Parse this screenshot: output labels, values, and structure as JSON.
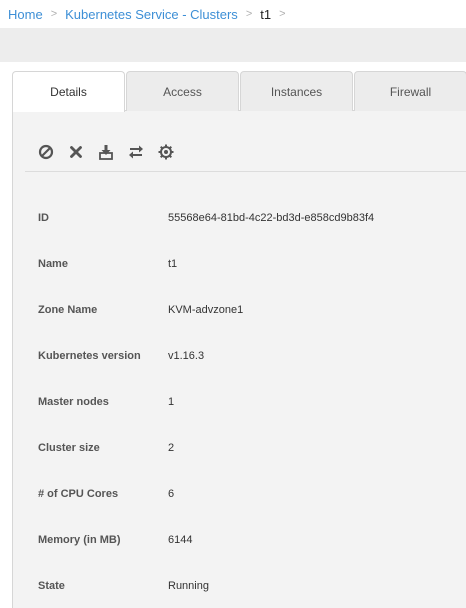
{
  "breadcrumb": {
    "home": "Home",
    "section": "Kubernetes Service - Clusters",
    "current": "t1",
    "separator": ">"
  },
  "tabs": [
    {
      "label": "Details",
      "active": true
    },
    {
      "label": "Access",
      "active": false
    },
    {
      "label": "Instances",
      "active": false
    },
    {
      "label": "Firewall",
      "active": false
    }
  ],
  "actions": [
    {
      "icon": "ban-icon"
    },
    {
      "icon": "close-icon"
    },
    {
      "icon": "download-icon"
    },
    {
      "icon": "swap-icon"
    },
    {
      "icon": "gear-icon"
    }
  ],
  "details": [
    {
      "label": "ID",
      "value": "55568e64-81bd-4c22-bd3d-e858cd9b83f4"
    },
    {
      "label": "Name",
      "value": "t1"
    },
    {
      "label": "Zone Name",
      "value": "KVM-advzone1"
    },
    {
      "label": "Kubernetes version",
      "value": "v1.16.3"
    },
    {
      "label": "Master nodes",
      "value": "1"
    },
    {
      "label": "Cluster size",
      "value": "2"
    },
    {
      "label": "# of CPU Cores",
      "value": "6"
    },
    {
      "label": "Memory (in MB)",
      "value": "6144"
    },
    {
      "label": "State",
      "value": "Running"
    }
  ]
}
